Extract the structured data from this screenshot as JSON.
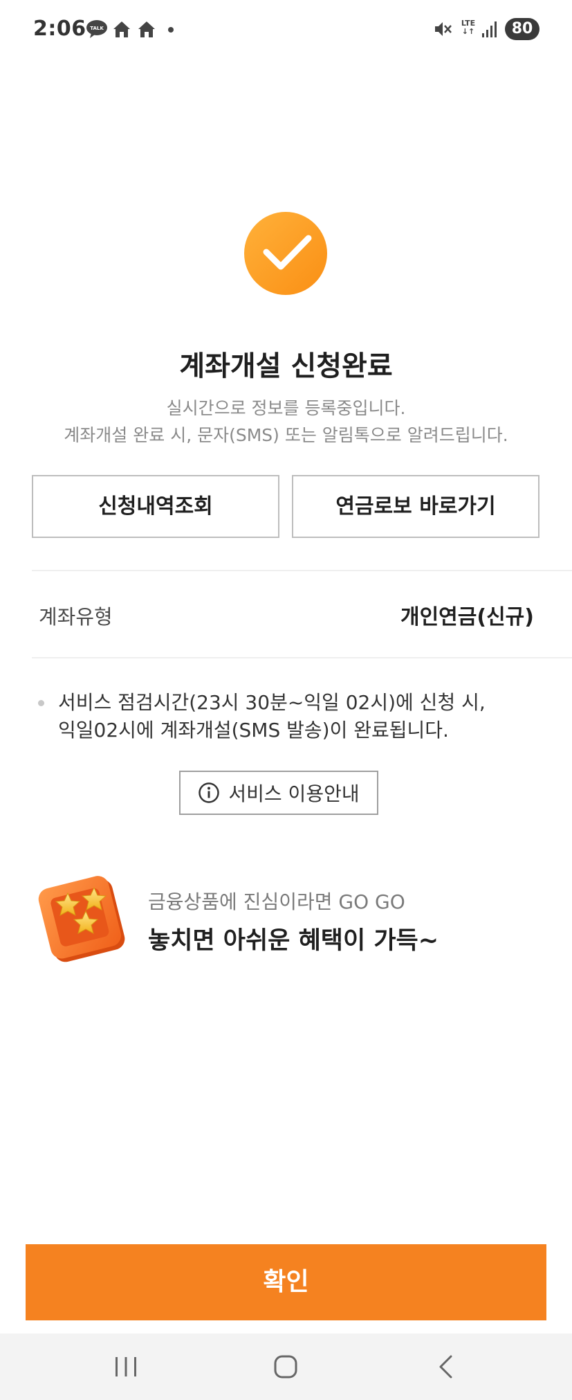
{
  "status_bar": {
    "time": "2:06",
    "network": "LTE",
    "battery": "80",
    "icons": [
      "kakaotalk-icon",
      "home-icon",
      "home-icon",
      "dot-icon",
      "mute-icon",
      "signal-icon",
      "battery-icon"
    ]
  },
  "result": {
    "icon": "check-circle-icon",
    "title": "계좌개설 신청완료",
    "desc_line1": "실시간으로 정보를 등록중입니다.",
    "desc_line2": "계좌개설 완료 시, 문자(SMS) 또는 알림톡으로 알려드립니다."
  },
  "buttons": {
    "history": "신청내역조회",
    "robo": "연금로보 바로가기"
  },
  "account": {
    "label": "계좌유형",
    "value": "개인연금(신규)"
  },
  "notice": {
    "line1": "서비스 점검시간(23시 30분~익일 02시)에 신청 시,",
    "line2": "익일02시에 계좌개설(SMS 발송)이  완료됩니다."
  },
  "guide_button": {
    "icon": "info-icon",
    "label": "서비스 이용안내"
  },
  "promo": {
    "icon": "stars-box-icon",
    "subtitle": "금융상품에 진심이라면 GO GO",
    "title": "놓치면 아쉬운 혜택이 가득~"
  },
  "confirm_button": "확인",
  "nav": {
    "icons": [
      "recent-apps-icon",
      "home-icon",
      "back-icon"
    ]
  },
  "colors": {
    "accent": "#f58220",
    "check_gradient_start": "#ffb13a",
    "check_gradient_end": "#fa8f14",
    "text_primary": "#1f1f1f",
    "text_secondary": "#8a8a8a"
  }
}
